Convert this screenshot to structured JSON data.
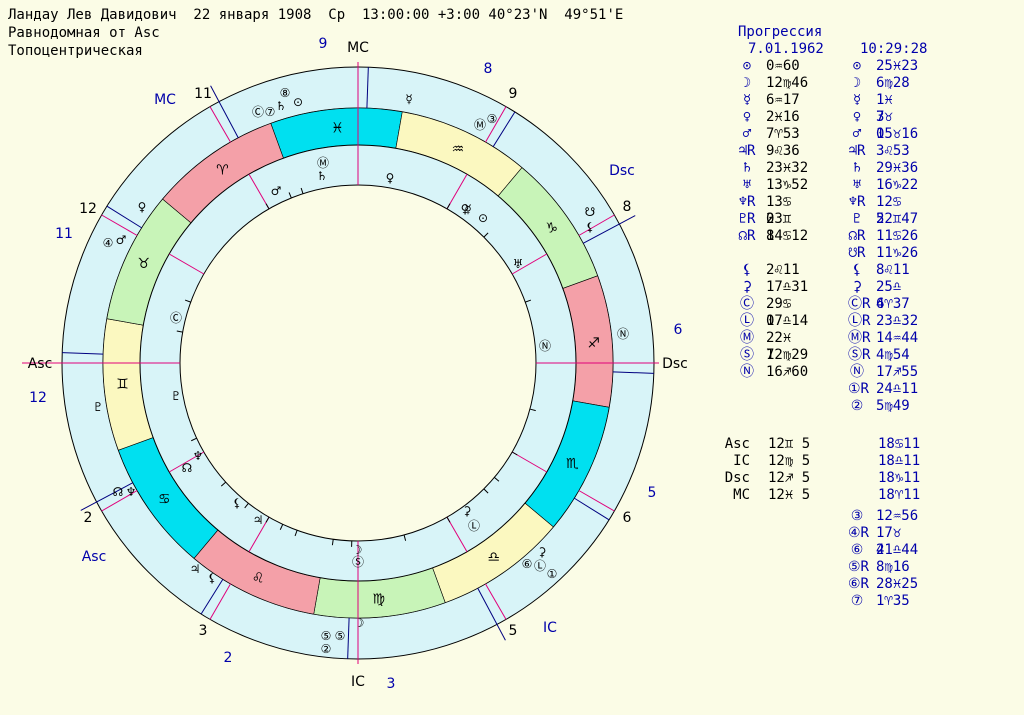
{
  "header": {
    "line1": "Ландау Лев Давидович  22 января 1908  Ср  13:00:00 +3:00 40°23'N  49°51'E",
    "line2": "Равнодомная от Asc",
    "line3": "Топоцентрическая"
  },
  "progression": {
    "title": "Прогрессия",
    "date": "7.01.1962",
    "time": "10:29:28"
  },
  "colors": {
    "background": "#fbfce6",
    "ring": "#d8f4f8",
    "fire": "#f4a0a8",
    "earth": "#c8f4b8",
    "air": "#fbf8c0",
    "water": "#00e0f0",
    "cusp_line": "#e0007a",
    "axis_line": "#000080",
    "text_blue": "#0000aa"
  },
  "natal_positions": [
    {
      "sym": "⊙",
      "val": "0♒60"
    },
    {
      "sym": "☽",
      "val": "12♍46"
    },
    {
      "sym": "☿",
      "val": "6♒17"
    },
    {
      "sym": "♀",
      "val": "2♓16"
    },
    {
      "sym": "♂",
      "val": "7♈53"
    },
    {
      "sym": "♃R",
      "val": "9♌36"
    },
    {
      "sym": "♄",
      "val": "23♓32"
    },
    {
      "sym": "♅",
      "val": "13♑52"
    },
    {
      "sym": "♆R",
      "val": "13♋ 0"
    },
    {
      "sym": "♇R",
      "val": "23♊ 8"
    },
    {
      "sym": "☊R",
      "val": "14♋12"
    },
    {
      "sym": "⚸",
      "val": "2♌11"
    },
    {
      "sym": "⚳",
      "val": "17♎31"
    },
    {
      "sym": "Ⓒ",
      "val": "29♋ 0"
    },
    {
      "sym": "Ⓛ",
      "val": "17♎14"
    },
    {
      "sym": "Ⓜ",
      "val": "22♓ 7"
    },
    {
      "sym": "Ⓢ",
      "val": "12♍29"
    },
    {
      "sym": "Ⓝ",
      "val": "16♐60"
    }
  ],
  "progressed_positions": [
    {
      "sym": "⊙",
      "val": "25♓23"
    },
    {
      "sym": "☽",
      "val": "6♍28"
    },
    {
      "sym": "☿",
      "val": "1♓ 3"
    },
    {
      "sym": "♀",
      "val": "7♉ 0"
    },
    {
      "sym": "♂",
      "val": "15♉16"
    },
    {
      "sym": "♃R",
      "val": "3♌53"
    },
    {
      "sym": "♄",
      "val": "29♓36"
    },
    {
      "sym": "♅",
      "val": "16♑22"
    },
    {
      "sym": "♆R",
      "val": "12♋ 5"
    },
    {
      "sym": "♇",
      "val": "22♊47"
    },
    {
      "sym": "☊R",
      "val": "11♋26"
    },
    {
      "sym": "☋R",
      "val": "11♑26"
    },
    {
      "sym": "⚸",
      "val": "8♌11"
    },
    {
      "sym": "⚳",
      "val": "25♎ 6"
    },
    {
      "sym": "ⒸR",
      "val": "4♈37"
    },
    {
      "sym": "ⓁR",
      "val": "23♎32"
    },
    {
      "sym": "ⓂR",
      "val": "14♒44"
    },
    {
      "sym": "ⓈR",
      "val": "4♍54"
    },
    {
      "sym": "Ⓝ",
      "val": "17♐55"
    },
    {
      "sym": "①R",
      "val": "24♎11"
    },
    {
      "sym": "②",
      "val": "5♍49"
    }
  ],
  "angles": [
    {
      "name": "Asc",
      "natal": "12♊ 5",
      "prog": "18♋11"
    },
    {
      "name": "IC",
      "natal": "12♍ 5",
      "prog": "18♎11"
    },
    {
      "name": "Dsc",
      "natal": "12♐ 5",
      "prog": "18♑11"
    },
    {
      "name": "MC",
      "natal": "12♓ 5",
      "prog": "18♈11"
    }
  ],
  "extra_points": [
    {
      "sym": "③",
      "val": "12♒56"
    },
    {
      "sym": "④R",
      "val": "17♉ 4"
    },
    {
      "sym": "⑥",
      "val": "21♎44"
    },
    {
      "sym": "⑤R",
      "val": "8♍16"
    },
    {
      "sym": "⑥R",
      "val": "28♓25"
    },
    {
      "sym": "⑦",
      "val": "1♈35"
    }
  ],
  "chart_labels": {
    "mc_top": "MC",
    "ic_bottom": "IC",
    "asc_left": "Asc",
    "dsc_right": "Dsc",
    "prog_mc": "MC",
    "prog_asc": "Asc",
    "prog_dsc": "Dsc",
    "prog_ic": "IC"
  },
  "house_numbers_inner": [
    "12",
    "11",
    "9",
    "8",
    "6",
    "5",
    "3",
    "2"
  ],
  "house_numbers_outer": [
    "11",
    "9",
    "8",
    "6",
    "5",
    "3",
    "2",
    "12"
  ],
  "zodiac": [
    {
      "sign": "♓",
      "element": "water"
    },
    {
      "sign": "♒",
      "element": "air"
    },
    {
      "sign": "♑",
      "element": "earth"
    },
    {
      "sign": "♐",
      "element": "fire"
    },
    {
      "sign": "♏",
      "element": "water"
    },
    {
      "sign": "♎",
      "element": "air"
    },
    {
      "sign": "♍",
      "element": "earth"
    },
    {
      "sign": "♌",
      "element": "fire"
    },
    {
      "sign": "♋",
      "element": "water"
    },
    {
      "sign": "♊",
      "element": "air"
    },
    {
      "sign": "♉",
      "element": "earth"
    },
    {
      "sign": "♈",
      "element": "fire"
    }
  ]
}
